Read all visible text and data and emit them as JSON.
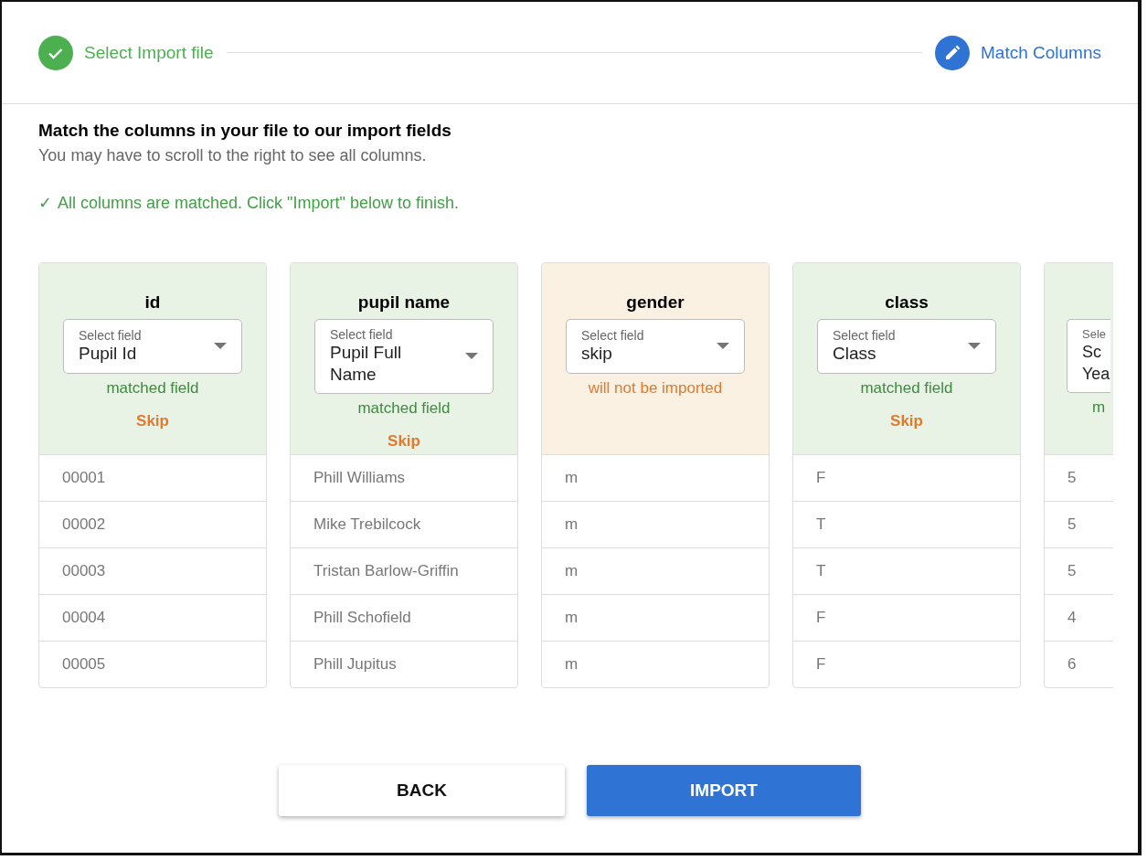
{
  "stepper": {
    "steps": [
      {
        "label": "Select Import file",
        "completed": true,
        "selected": false
      },
      {
        "label": "Match Columns",
        "completed": false,
        "selected": true
      }
    ]
  },
  "heading": "Match the columns in your file to our import fields",
  "subheading": "You may have to scroll to the right to see all columns.",
  "success_message": {
    "icon": "✓",
    "text": "All columns are matched. Click \"Import\" below to finish."
  },
  "columns": [
    {
      "kind": "matched",
      "name": "id",
      "select": {
        "label": "Select field",
        "value": "Pupil Id"
      },
      "status": "matched field",
      "skip": "Skip",
      "cells": [
        "00001",
        "00002",
        "00003",
        "00004",
        "00005"
      ]
    },
    {
      "kind": "matched",
      "name": "pupil name",
      "select": {
        "label": "Select field",
        "value": "Pupil Full Name"
      },
      "status": "matched field",
      "skip": "Skip",
      "cells": [
        "Phill Williams",
        "Mike Trebilcock",
        "Tristan Barlow-Griffin",
        "Phill Schofield",
        "Phill Jupitus"
      ]
    },
    {
      "kind": "skipped",
      "name": "gender",
      "select": {
        "label": "Select field",
        "value": "skip"
      },
      "status": "will not be imported",
      "cells": [
        "m",
        "m",
        "m",
        "m",
        "m"
      ]
    },
    {
      "kind": "matched",
      "name": "class",
      "select": {
        "label": "Select field",
        "value": "Class"
      },
      "status": "matched field",
      "skip": "Skip",
      "cells": [
        "F",
        "T",
        "T",
        "F",
        "F"
      ]
    },
    {
      "kind": "partial",
      "select": {
        "label": "Sele",
        "value": "Sc Yea"
      },
      "status": "m",
      "cells": [
        "5",
        "5",
        "5",
        "4",
        "6"
      ]
    }
  ],
  "buttons": [
    {
      "label": "BACK",
      "kind": "secondary"
    },
    {
      "label": "IMPORT",
      "kind": "primary"
    }
  ]
}
